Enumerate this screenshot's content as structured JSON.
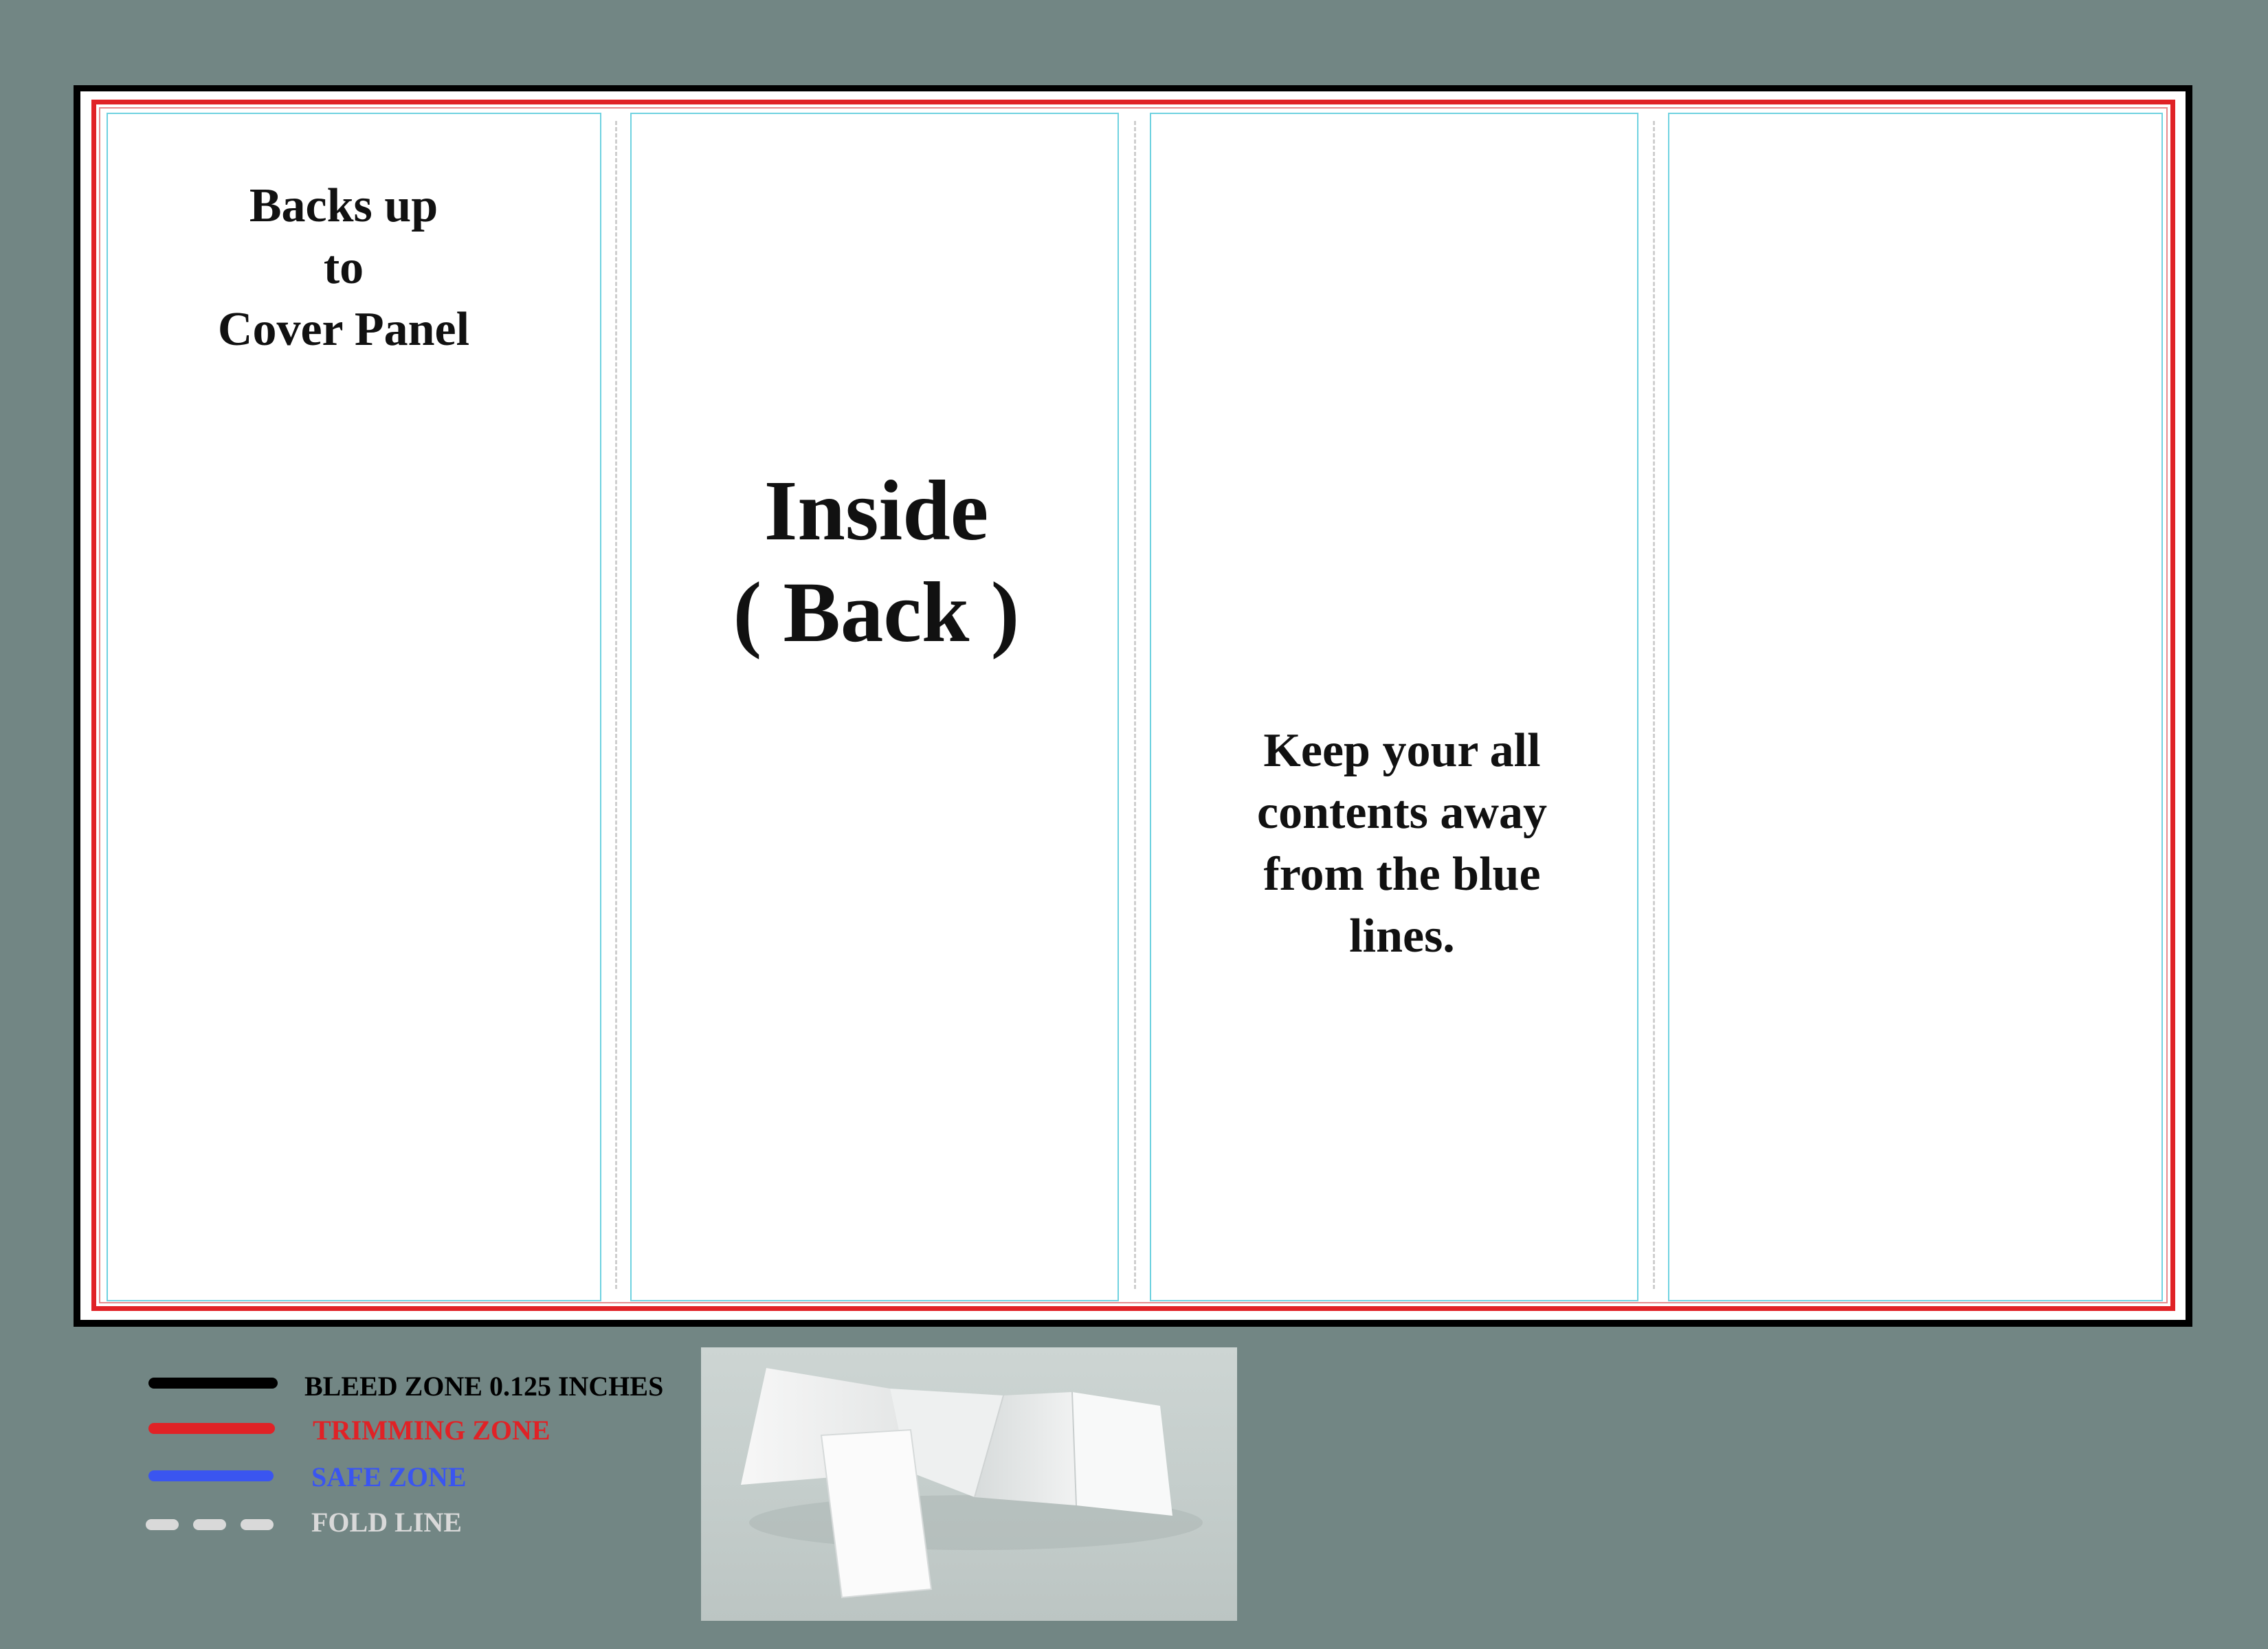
{
  "panels": {
    "left_text": [
      "Backs up",
      "to",
      "Cover Panel"
    ],
    "center_text": [
      "Inside",
      "( Back )"
    ],
    "right_text": [
      "Keep your all",
      "contents away",
      "from the blue",
      "lines."
    ]
  },
  "legend": {
    "bleed": "BLEED ZONE 0.125 INCHES",
    "trim": "TRIMMING ZONE",
    "safe": "SAFE ZONE",
    "fold": "FOLD LINE"
  },
  "colors": {
    "background": "#728684",
    "bleed": "#000000",
    "trim": "#e02226",
    "safe": "#3a55f0",
    "safe_guide": "#6fd2e0",
    "fold": "#d9d9d9"
  },
  "image": {
    "subject": "folded-brochure-mockup-icon"
  }
}
